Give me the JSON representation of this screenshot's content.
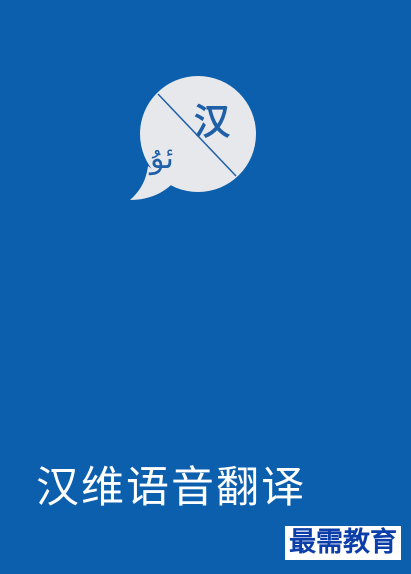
{
  "app": {
    "title": "汉维语音翻译",
    "background_color": "#0b5fad"
  },
  "logo": {
    "icon": "speech-bubble-translate-icon",
    "chinese_char": "汉",
    "uyghur_char": "ئۇ",
    "bubble_color": "#e6e8ec",
    "glyph_color": "#1f5fa8"
  },
  "watermark": {
    "text": "最需教育"
  }
}
